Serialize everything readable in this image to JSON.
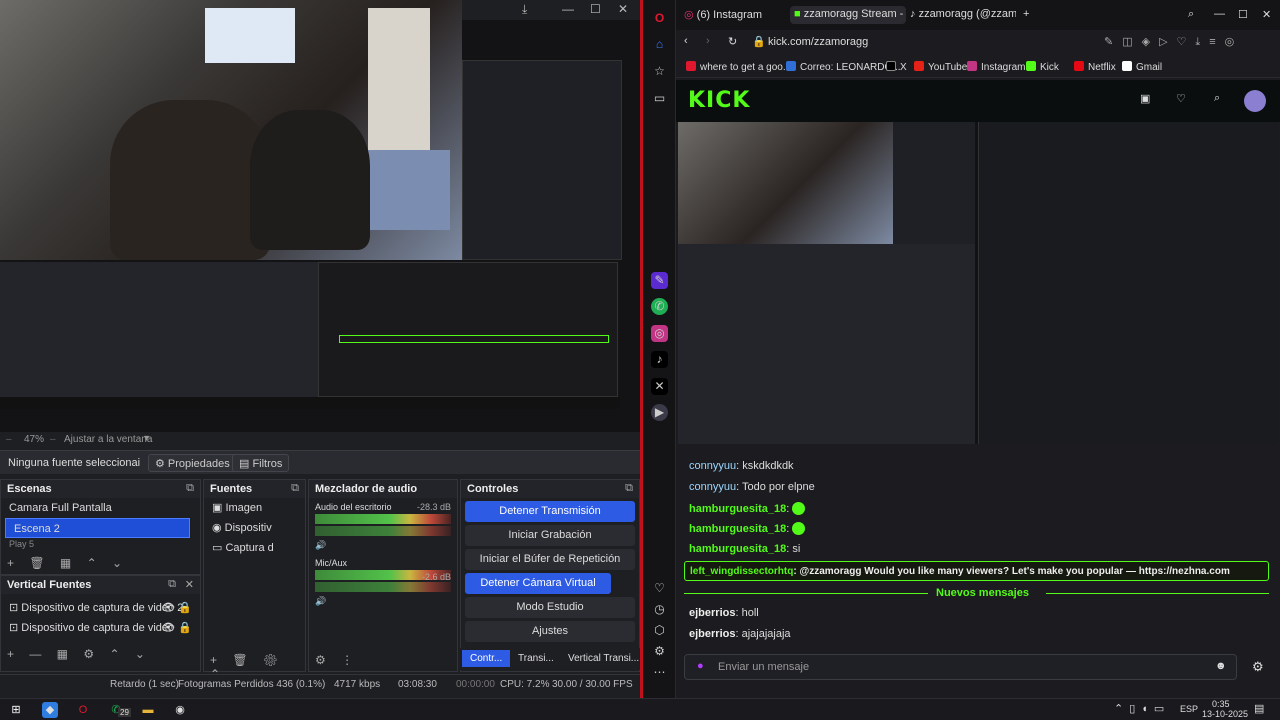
{
  "obs": {
    "zoom": "47%",
    "fit_label": "Ajustar a la ventana",
    "no_source": "Ninguna fuente seleccionai",
    "properties": "Propiedades",
    "filters": "Filtros",
    "scenes": {
      "title": "Escenas",
      "items": [
        "Camara Full Pantalla",
        "Escena 2",
        "Play 5"
      ],
      "selected": 1
    },
    "sources": {
      "title": "Fuentes",
      "items": [
        "Imagen",
        "Dispositiv",
        "Captura d"
      ]
    },
    "mixer": {
      "title": "Mezclador de audio",
      "channels": [
        {
          "name": "Audio del escritorio",
          "db": "-28.3 dB"
        },
        {
          "name": "Mic/Aux",
          "db": "-2.6 dB"
        }
      ]
    },
    "controls": {
      "title": "Controles",
      "buttons": [
        "Detener Transmisión",
        "Iniciar Grabación",
        "Iniciar el Búfer de Repetición",
        "Detener Cámara Virtual",
        "Modo Estudio",
        "Ajustes"
      ]
    },
    "vertical": {
      "title": "Vertical Fuentes",
      "items": [
        "Dispositivo de captura de video 2",
        "Dispositivo de captura de video"
      ]
    },
    "bottom_tabs": [
      "Contr...",
      "Transi...",
      "Vertical Transi..."
    ],
    "status": {
      "delay": "Retardo (1 sec)",
      "dropped": "Fotogramas Perdidos 436 (0.1%)",
      "kbps": "4717 kbps",
      "time": "03:08:30",
      "rec": "00:00:00",
      "cpu": "CPU: 7.2%",
      "fps": "30.00 / 30.00 FPS"
    }
  },
  "browser": {
    "tabs": [
      "(6) Instagram",
      "zzamoragg Stream - Wat",
      "zzamoragg (@zzamo"
    ],
    "url": "kick.com/zzamoragg",
    "bookmarks": [
      "where to get a goo...",
      "Correo: LEONARDO...",
      "X",
      "YouTube",
      "Instagram",
      "Kick",
      "Netflix",
      "Gmail"
    ]
  },
  "kick": {
    "logo": "KICK",
    "messages": [
      {
        "user": "connyyuu",
        "text": ": kskdkdkdk"
      },
      {
        "user": "connyyuu",
        "text": ": Todo por elpne"
      },
      {
        "user": "hamburguesita_18",
        "text": ":"
      },
      {
        "user": "hamburguesita_18",
        "text": ":"
      },
      {
        "user": "hamburguesita_18",
        "text": ": si"
      }
    ],
    "highlight": {
      "user": "left_wingdissectorhtq",
      "text": ": @zzamoragg Would you like many viewers? Let's make you popular — https://nezhna.com"
    },
    "new_messages": "Nuevos mensajes",
    "after": [
      {
        "user": "ejberrios",
        "text": ": holl"
      },
      {
        "user": "ejberrios",
        "text": ": ajajajajaja"
      }
    ],
    "chat_placeholder": "Enviar un mensaje"
  },
  "taskbar": {
    "lang": "ESP",
    "time": "0:35",
    "date": "13-10-2025",
    "badge": "29"
  }
}
